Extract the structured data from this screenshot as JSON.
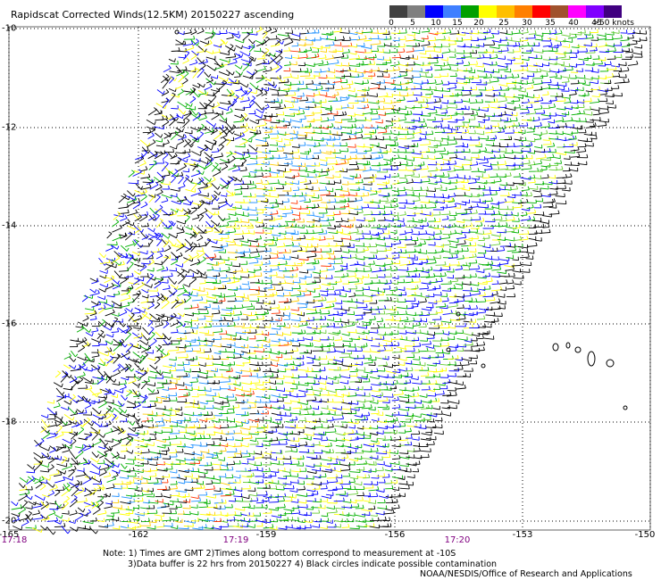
{
  "title": "Rapidscat Corrected Winds(12.5KM) 20150227 ascending",
  "colorbar": {
    "labels": [
      "0",
      "5",
      "10",
      "15",
      "20",
      "25",
      "30",
      "35",
      "40",
      "45",
      ">50 knots"
    ],
    "colors": [
      "#404040",
      "#7f7f7f",
      "#0000ff",
      "#3f7fff",
      "#00a000",
      "#ffff00",
      "#ffbf00",
      "#ff7f00",
      "#ff0000",
      "#a0522d",
      "#ff00ff",
      "#8000ff",
      "#400080"
    ]
  },
  "lat_labels": [
    "-10",
    "-12",
    "-14",
    "-16",
    "-18",
    "-20"
  ],
  "lon_labels": [
    "-165",
    "-162",
    "-159",
    "-156",
    "-153",
    "-150"
  ],
  "time_labels": [
    "17:18",
    "17:19",
    "17:20"
  ],
  "note_line1": "Note: 1) Times are GMT 2)Times along bottom correspond to measurement at -10S",
  "note_line2": "3)Data buffer is 22 hrs from 20150227 4) Black circles indicate possible contamination",
  "credit": "NOAA/NESDIS/Office of Research and Applications",
  "wind_colors": [
    "#000000",
    "#0000ff",
    "#1e90ff",
    "#00b000",
    "#66cc33",
    "#ffff00",
    "#ffcc00",
    "#ff8800",
    "#ff3300"
  ]
}
